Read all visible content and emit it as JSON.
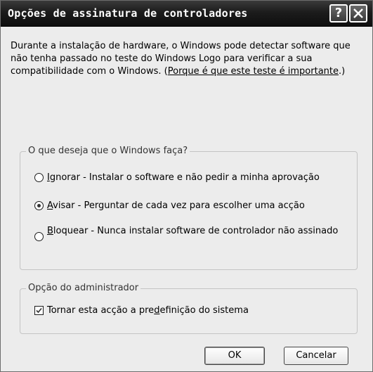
{
  "window": {
    "title": "Opções de assinatura de controladores",
    "help_glyph": "?"
  },
  "description": {
    "text": "Durante a instalação de hardware, o Windows pode detectar software que não tenha passado no teste do Windows Logo para verificar a sua compatibilidade com o Windows. (",
    "link": "Porque é que este teste é importante",
    "suffix": ".)"
  },
  "behavior_group": {
    "legend": "O que deseja que o Windows faça?",
    "options": [
      {
        "mnemonic": "I",
        "rest": "gnorar - Instalar o software e não pedir a minha aprovação",
        "checked": false
      },
      {
        "mnemonic": "A",
        "rest": "visar - Perguntar de cada vez para escolher uma acção",
        "checked": true
      },
      {
        "mnemonic": "B",
        "rest": "loquear - Nunca instalar software de controlador não assinado",
        "checked": false
      }
    ]
  },
  "admin_group": {
    "legend": "Opção do administrador",
    "checkbox_pre": "Tornar esta acção a pre",
    "checkbox_mnemonic": "d",
    "checkbox_post": "efinição do sistema",
    "checked": true
  },
  "buttons": {
    "ok": "OK",
    "cancel": "Cancelar"
  }
}
